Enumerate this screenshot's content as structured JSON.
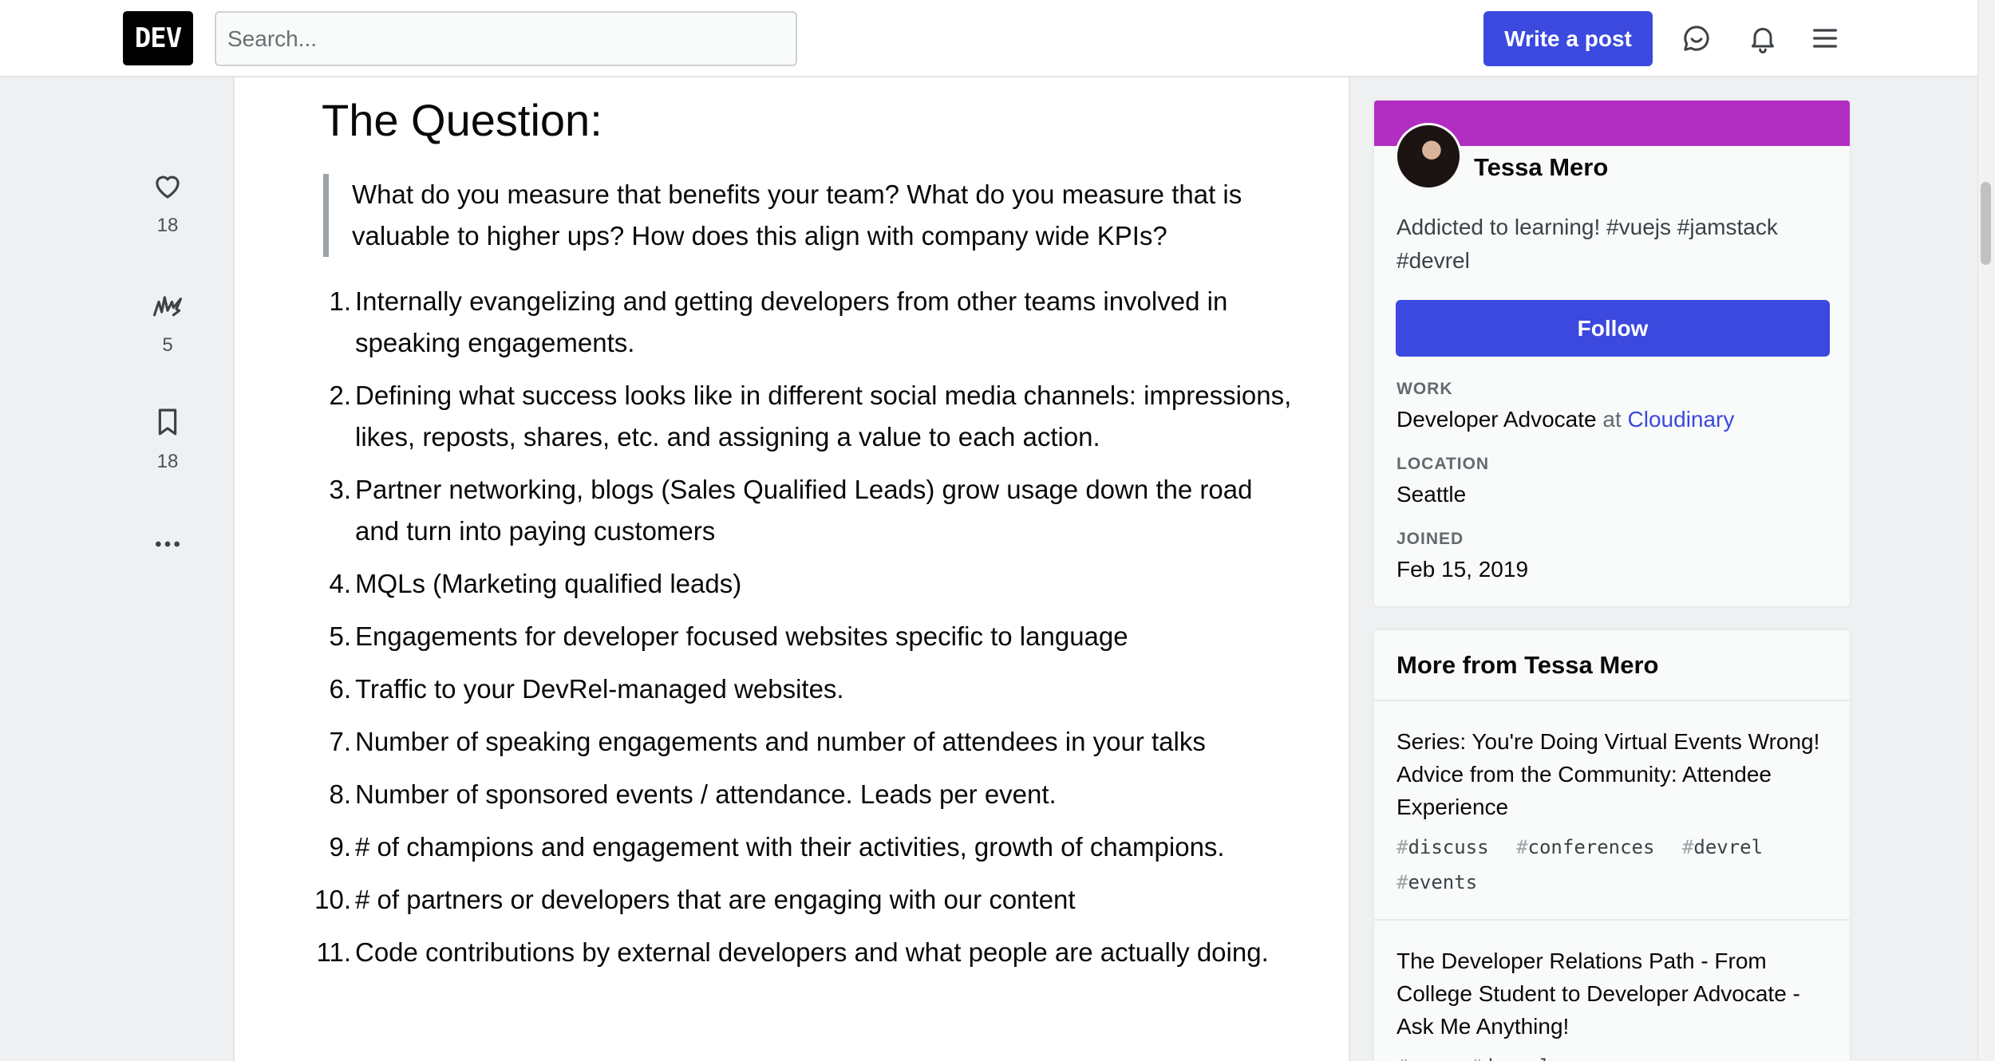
{
  "header": {
    "logo_text": "DEV",
    "search_placeholder": "Search...",
    "write_button": "Write a post",
    "icons": [
      "connect-chat-icon",
      "notifications-bell-icon",
      "menu-icon"
    ]
  },
  "reactions": {
    "likes": "18",
    "unicorns": "5",
    "bookmarks": "18",
    "icons": [
      "heart-icon",
      "unicorn-icon",
      "bookmark-icon",
      "more-options-icon"
    ]
  },
  "article": {
    "heading": "The Question:",
    "quote": "What do you measure that benefits your team? What do you measure that is valuable to higher ups? How does this align with company wide KPIs?",
    "items": [
      {
        "num": "1.",
        "text": "Internally evangelizing and getting developers from other teams involved in speaking engagements."
      },
      {
        "num": "2.",
        "text": "Defining what success looks like in different social media channels: impressions, likes, reposts, shares, etc. and assigning a value to each action."
      },
      {
        "num": "3.",
        "text": "Partner networking, blogs (Sales Qualified Leads) grow usage down the road and turn into paying customers"
      },
      {
        "num": "4.",
        "text": "MQLs (Marketing qualified leads)"
      },
      {
        "num": "5.",
        "text": "Engagements for developer focused websites specific to language"
      },
      {
        "num": "6.",
        "text": "Traffic to your DevRel-managed websites."
      },
      {
        "num": "7.",
        "text": "Number of speaking engagements and number of attendees in your talks"
      },
      {
        "num": "8.",
        "text": "Number of sponsored events / attendance. Leads per event."
      },
      {
        "num": "9.",
        "text": "# of champions and engagement with their activities, growth of champions."
      },
      {
        "num": "10.",
        "text": "# of partners or developers that are engaging with our content"
      },
      {
        "num": "11.",
        "text": "Code contributions by external developers and what people are actually doing."
      }
    ]
  },
  "profile": {
    "name": "Tessa Mero",
    "bio": "Addicted to learning! #vuejs #jamstack #devrel",
    "follow_button": "Follow",
    "work_label": "WORK",
    "work_role": "Developer Advocate",
    "work_at": "at",
    "work_company": "Cloudinary",
    "location_label": "LOCATION",
    "location": "Seattle",
    "joined_label": "JOINED",
    "joined": "Feb 15, 2019",
    "banner_color": "#b22dc1"
  },
  "more_from": {
    "title": "More from Tessa Mero",
    "posts": [
      {
        "title": "Series: You're Doing Virtual Events Wrong! Advice from the Community: Attendee Experience",
        "tags": [
          "discuss",
          "conferences",
          "devrel",
          "events"
        ]
      },
      {
        "title": "The Developer Relations Path - From College Student to Developer Advocate - Ask Me Anything!",
        "tags": [
          "ama",
          "devrel"
        ]
      }
    ]
  },
  "colors": {
    "accent": "#3b49df",
    "background": "#eef0f1"
  }
}
